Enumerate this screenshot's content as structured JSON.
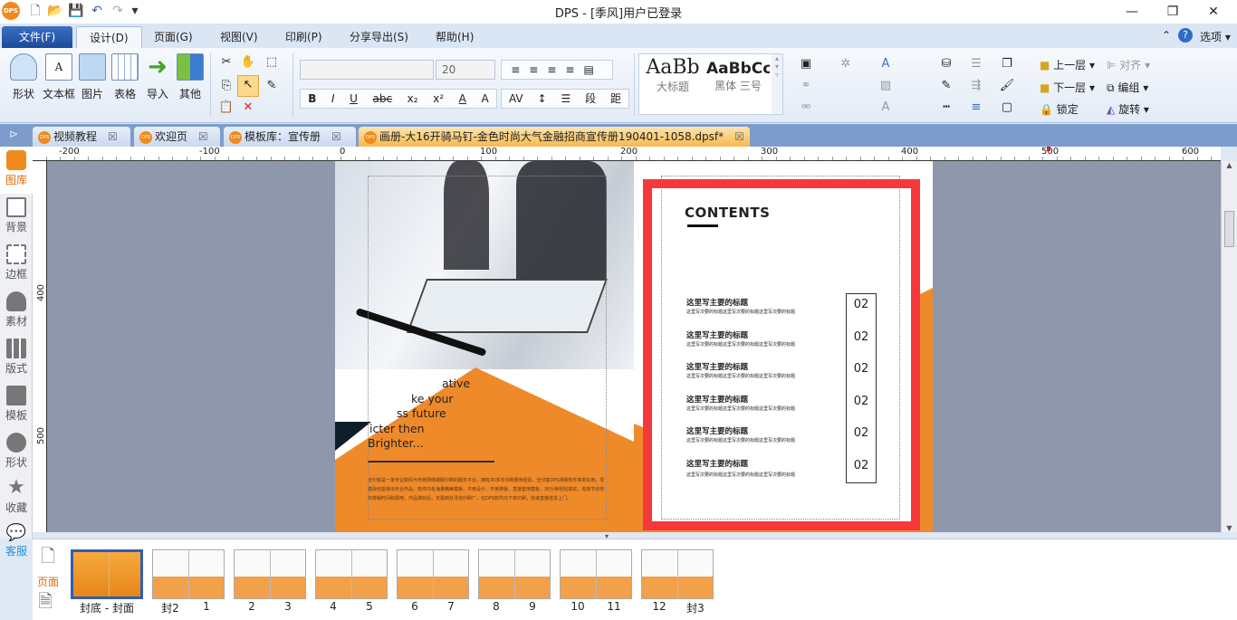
{
  "titlebar": {
    "title": "DPS - [季风]用户已登录",
    "logo": "DPS"
  },
  "menu": {
    "file": "文件(F)",
    "items": [
      "设计(D)",
      "页面(G)",
      "视图(V)",
      "印刷(P)",
      "分享导出(S)",
      "帮助(H)"
    ],
    "options": "选项"
  },
  "ribbon": {
    "insert": [
      "形状",
      "文本框",
      "图片",
      "表格",
      "导入",
      "其他"
    ],
    "font_name": "",
    "font_size": "20",
    "format_buttons": [
      "B",
      "I",
      "U",
      "abc",
      "x₂",
      "x²",
      "A",
      "A",
      "AV",
      "段",
      "距"
    ],
    "styles": [
      {
        "sample": "AaBb",
        "label": "大标题"
      },
      {
        "sample": "AaBbCc",
        "label": "黑体 三号"
      }
    ],
    "arrange": [
      "上一层",
      "对齐",
      "下一层",
      "编组",
      "锁定",
      "旋转"
    ]
  },
  "doc_tabs": [
    {
      "label": "视频教程"
    },
    {
      "label": "欢迎页"
    },
    {
      "label": "模板库：宣传册"
    },
    {
      "label": "画册-大16开骑马钉-金色时尚大气金融招商宣传册190401-1058.dpsf*",
      "active": true
    }
  ],
  "sidebar": [
    "图库",
    "背景",
    "边框",
    "素材",
    "版式",
    "模板",
    "形状",
    "收藏",
    "客服"
  ],
  "rulers": {
    "h": [
      "-200",
      "-100",
      "0",
      "100",
      "200",
      "300",
      "400",
      "500",
      "600"
    ],
    "v": [
      "400",
      "500"
    ]
  },
  "left_page": {
    "lines": [
      "ative",
      "ke your",
      "ss future",
      "icter then",
      "Brighter..."
    ],
    "body": "全印客是一家专业数码与传统网络端服印刷的服务平台，拥有30多年印刷服务经验，全印客DPS排版软件简单好用，零基础也能排出专业作品，软件内有海量精美模板，不用设计，不用排版，直接套用模板，30分钟轻松搞定，有效节省你的排版时间和费用，作品排好后，无需到处寻找印刷厂，在DPS软件内下单印刷，快速直接送货上门。"
  },
  "right_page": {
    "heading": "CONTENTS",
    "items": [
      {
        "title": "这里写主要的标题",
        "sub": "这里写次要的标题这里写次要的标题这里写次要的标题",
        "num": "02"
      },
      {
        "title": "这里写主要的标题",
        "sub": "这里写次要的标题这里写次要的标题这里写次要的标题",
        "num": "02"
      },
      {
        "title": "这里写主要的标题",
        "sub": "这里写次要的标题这里写次要的标题这里写次要的标题",
        "num": "02"
      },
      {
        "title": "这里写主要的标题",
        "sub": "这里写次要的标题这里写次要的标题这里写次要的标题",
        "num": "02"
      },
      {
        "title": "这里写主要的标题",
        "sub": "这里写次要的标题这里写次要的标题这里写次要的标题",
        "num": "02"
      },
      {
        "title": "这里写主要的标题",
        "sub": "这里写次要的标题这里写次要的标题这里写次要的标题",
        "num": "02"
      }
    ]
  },
  "bottom": {
    "pages_tab": "页面",
    "thumbs": [
      [
        "封底 - 封面"
      ],
      [
        "封2",
        "1"
      ],
      [
        "2",
        "3"
      ],
      [
        "4",
        "5"
      ],
      [
        "6",
        "7"
      ],
      [
        "8",
        "9"
      ],
      [
        "10",
        "11"
      ],
      [
        "12",
        "封3"
      ]
    ]
  },
  "colors": {
    "accent": "#f08a2a",
    "highlight": "#f5383b",
    "canvas": "#8f97ab"
  }
}
